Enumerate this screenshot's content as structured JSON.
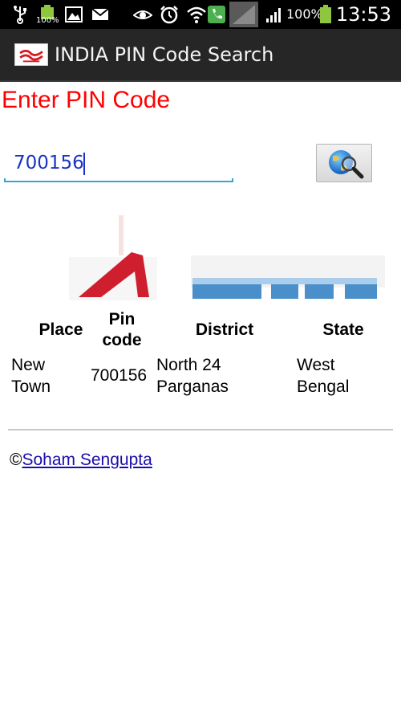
{
  "status_bar": {
    "battery_small_label": "100%",
    "battery_percent": "100%",
    "time": "13:53"
  },
  "action_bar": {
    "title": "INDIA PIN Code Search"
  },
  "form": {
    "heading": "Enter PIN Code",
    "pin_value": "700156",
    "search_icon": "globe-magnifier-icon"
  },
  "table": {
    "headers": {
      "place": "Place",
      "pin_code_line1": "Pin",
      "pin_code_line2": "code",
      "district": "District",
      "state": "State"
    },
    "rows": [
      {
        "place_line1": "New",
        "place_line2": "Town",
        "pin": "700156",
        "district_line1": "North 24",
        "district_line2": "Parganas",
        "state_line1": "West",
        "state_line2": "Bengal"
      }
    ]
  },
  "footer": {
    "copyright_symbol": "©",
    "author_link": "Soham Sengupta"
  },
  "colors": {
    "heading_red": "#ff0000",
    "input_text": "#1a33c4",
    "input_underline": "#33a5d6",
    "actionbar_bg": "#262626",
    "link_blue": "#1a0dab"
  }
}
